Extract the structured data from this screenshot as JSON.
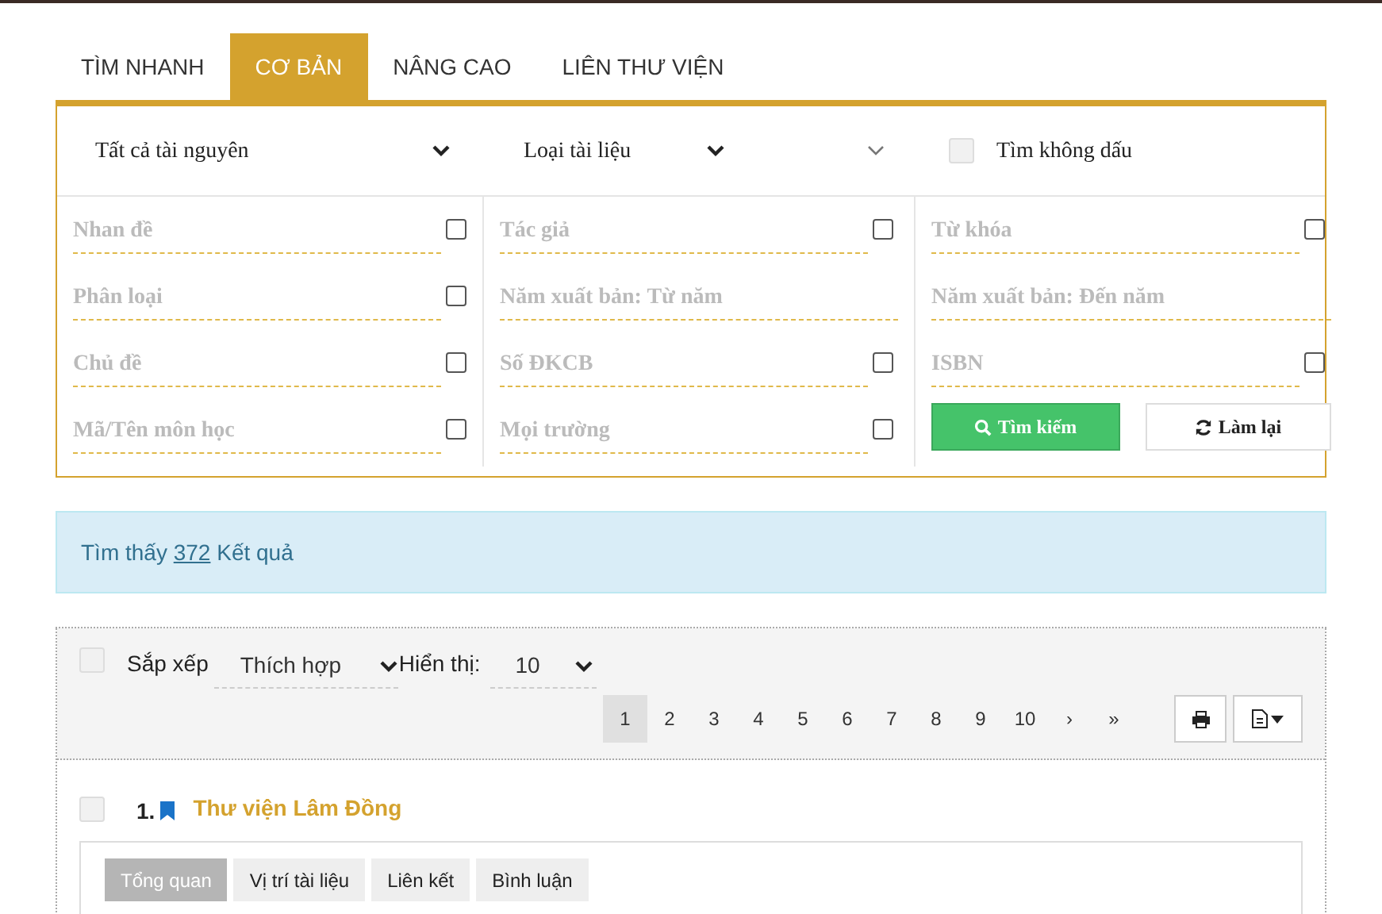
{
  "tabs": [
    {
      "label": "TÌM NHANH",
      "selected": false
    },
    {
      "label": "CƠ BẢN",
      "selected": true
    },
    {
      "label": "NÂNG CAO",
      "selected": false
    },
    {
      "label": "LIÊN THƯ VIỆN",
      "selected": false
    }
  ],
  "filters": {
    "resource": "Tất cả tài nguyên",
    "doc_type": "Loại tài liệu",
    "unaccented": {
      "label": "Tìm không dấu",
      "checked": false
    }
  },
  "field_columns": [
    [
      {
        "placeholder": "Nhan đề",
        "checked": false
      },
      {
        "placeholder": "Phân loại",
        "checked": false
      },
      {
        "placeholder": "Chủ đề",
        "checked": false
      },
      {
        "placeholder": "Mã/Tên môn học",
        "checked": false
      }
    ],
    [
      {
        "placeholder": "Tác giả",
        "checked": false
      },
      {
        "placeholder": "Năm xuất bản: Từ năm"
      },
      {
        "placeholder": "Số ĐKCB",
        "checked": false
      },
      {
        "placeholder": "Mọi trường",
        "checked": false
      }
    ],
    [
      {
        "placeholder": "Từ khóa",
        "checked": false
      },
      {
        "placeholder": "Năm xuất bản: Đến năm"
      },
      {
        "placeholder": "ISBN",
        "checked": false
      }
    ]
  ],
  "search_button": "Tìm kiếm",
  "reset_button": "Làm lại",
  "result_summary": {
    "before": "Tìm thấy",
    "count": "372",
    "after": "Kết quả"
  },
  "toolbar": {
    "select_all_checked": false,
    "sort_label": "Sắp xếp",
    "sort_value": "Thích hợp",
    "display_label": "Hiển thị:",
    "display_value": "10"
  },
  "pages": [
    {
      "label": "1",
      "selected": true
    },
    {
      "label": "2",
      "selected": false
    },
    {
      "label": "3",
      "selected": false
    },
    {
      "label": "4",
      "selected": false
    },
    {
      "label": "5",
      "selected": false
    },
    {
      "label": "6",
      "selected": false
    },
    {
      "label": "7",
      "selected": false
    },
    {
      "label": "8",
      "selected": false
    },
    {
      "label": "9",
      "selected": false
    },
    {
      "label": "10",
      "selected": false
    },
    {
      "label": "›",
      "selected": false
    },
    {
      "label": "»",
      "selected": false
    }
  ],
  "results": [
    {
      "number": "1.",
      "title": "Thư viện Lâm Đồng",
      "checked": false,
      "tabs": [
        {
          "label": "Tổng quan",
          "selected": true
        },
        {
          "label": "Vị trí tài liệu",
          "selected": false
        },
        {
          "label": "Liên kết",
          "selected": false
        },
        {
          "label": "Bình luận",
          "selected": false
        }
      ]
    }
  ]
}
